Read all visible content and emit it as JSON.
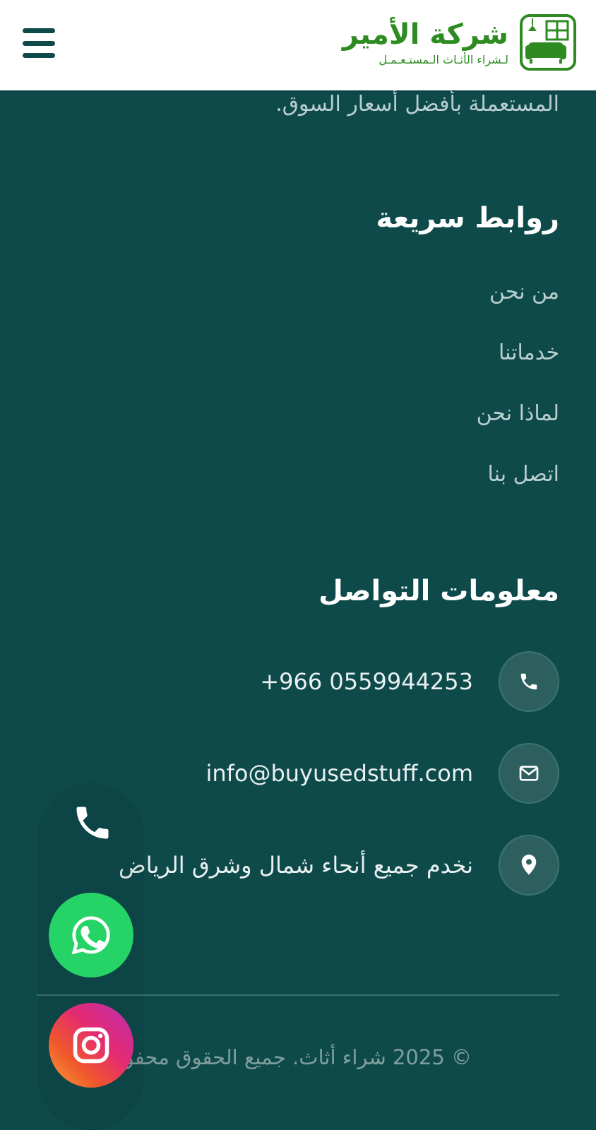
{
  "header": {
    "logo_title": "شركة الأمير",
    "logo_subtitle": "لـشراء الأثـاث الـمستـعـمـل",
    "menu_icon": "hamburger-menu-icon",
    "brand_color": "#2e8b22"
  },
  "about": {
    "tail_text": "المستعملة بأفضل أسعار السوق."
  },
  "quick_links": {
    "title": "روابط سريعة",
    "items": [
      "من نحن",
      "خدماتنا",
      "لماذا نحن",
      "اتصل بنا"
    ]
  },
  "contact": {
    "title": "معلومات التواصل",
    "phone": "+966 0559944253",
    "email": "info@buyusedstuff.com",
    "address": "نخدم جميع أنحاء شمال وشرق الرياض"
  },
  "footer": {
    "copyright": "© 2025 شراء أثاث. جميع الحقوق محفوظة"
  },
  "floating": {
    "icons": [
      "phone-icon",
      "whatsapp-icon",
      "instagram-icon"
    ],
    "whatsapp_color": "#25d366"
  },
  "colors": {
    "background": "#0f4a4b",
    "muted_text": "#b9cfcf"
  }
}
